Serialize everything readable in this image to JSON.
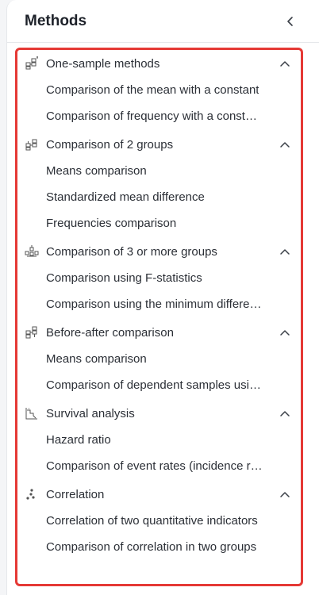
{
  "panel": {
    "title": "Methods",
    "collapse_icon": "chevron-left-icon"
  },
  "groups": [
    {
      "label": "One-sample methods",
      "icon": "one-sample-icon",
      "expanded": true,
      "items": [
        "Comparison of the mean with a constant",
        "Comparison of frequency with a const…"
      ]
    },
    {
      "label": "Comparison of 2 groups",
      "icon": "two-groups-icon",
      "expanded": true,
      "items": [
        "Means comparison",
        "Standardized mean difference",
        "Frequencies comparison"
      ]
    },
    {
      "label": "Comparison of 3 or more groups",
      "icon": "three-groups-icon",
      "expanded": true,
      "items": [
        "Comparison using F-statistics",
        "Comparison using the minimum differe…"
      ]
    },
    {
      "label": "Before-after comparison",
      "icon": "before-after-icon",
      "expanded": true,
      "items": [
        "Means comparison",
        "Comparison of dependent samples usi…"
      ]
    },
    {
      "label": "Survival analysis",
      "icon": "survival-icon",
      "expanded": true,
      "items": [
        "Hazard ratio",
        "Comparison of event rates (incidence r…"
      ]
    },
    {
      "label": "Correlation",
      "icon": "scatter-icon",
      "expanded": true,
      "items": [
        "Correlation of two quantitative indicators",
        "Comparison of correlation in two groups"
      ]
    }
  ],
  "colors": {
    "highlight": "#e53935",
    "text": "#2b2f36"
  }
}
